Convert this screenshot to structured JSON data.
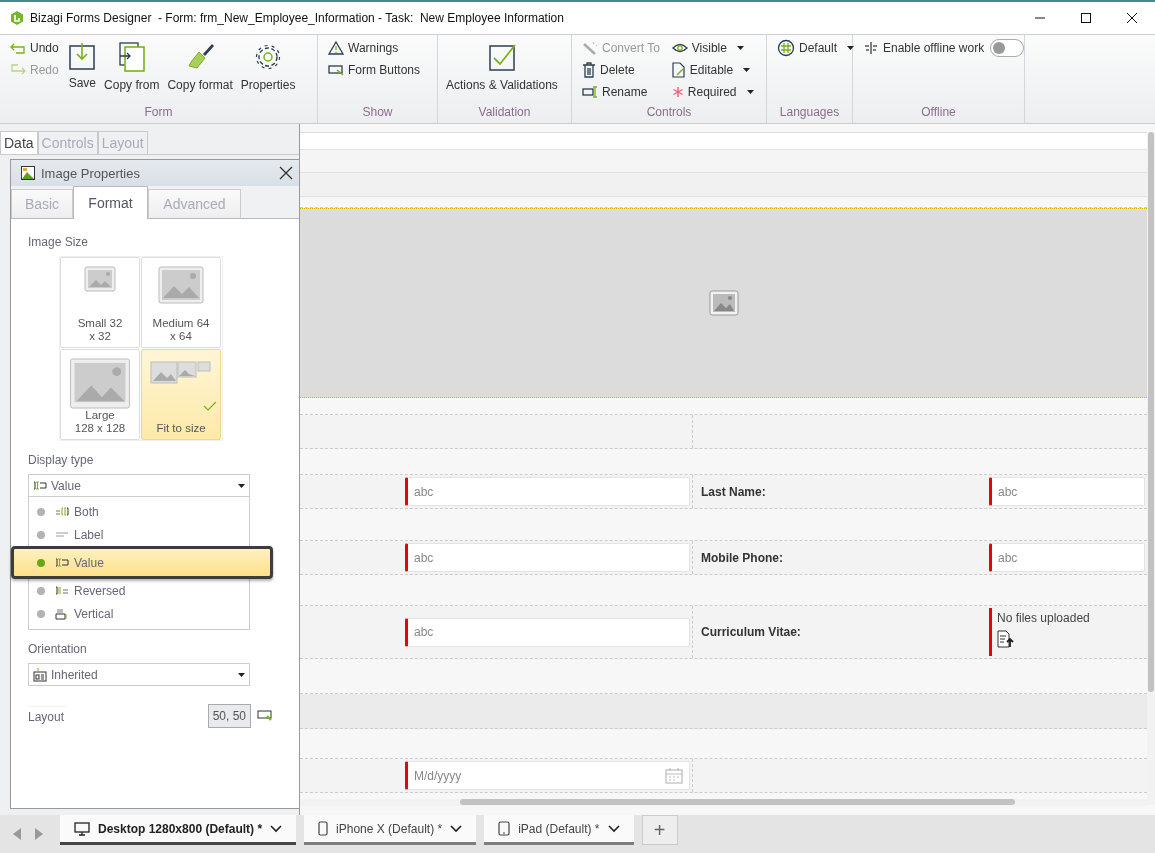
{
  "window": {
    "title": "Bizagi Forms Designer  - Form: frm_New_Employee_Information - Task:  New Employee Information"
  },
  "ribbon": {
    "groups": [
      {
        "label": "Form",
        "columns": [
          {
            "kind": "stack",
            "items": [
              {
                "label": "Undo",
                "disabled": false
              },
              {
                "label": "Redo",
                "disabled": true
              }
            ]
          },
          {
            "kind": "large",
            "items": [
              {
                "label": "Save",
                "disabled": false
              }
            ]
          },
          {
            "kind": "large",
            "items": [
              {
                "label": "Copy from",
                "disabled": false
              }
            ]
          },
          {
            "kind": "large",
            "items": [
              {
                "label": "Copy format",
                "disabled": false
              }
            ]
          },
          {
            "kind": "large",
            "items": [
              {
                "label": "Properties",
                "disabled": false
              }
            ]
          }
        ]
      },
      {
        "label": "Show",
        "columns": [
          {
            "kind": "stack",
            "items": [
              {
                "label": "Warnings",
                "disabled": false
              },
              {
                "label": "Form Buttons",
                "disabled": false
              }
            ]
          }
        ]
      },
      {
        "label": "Validation",
        "columns": [
          {
            "kind": "large",
            "items": [
              {
                "label": "Actions & Validations",
                "disabled": false
              }
            ]
          }
        ]
      },
      {
        "label": "Controls",
        "columns": [
          {
            "kind": "stack",
            "items": [
              {
                "label": "Convert To",
                "disabled": true
              },
              {
                "label": "Delete",
                "disabled": false
              },
              {
                "label": "Rename",
                "disabled": false
              }
            ]
          },
          {
            "kind": "stack",
            "items": [
              {
                "label": "Visible",
                "disabled": false,
                "dropdown": true
              },
              {
                "label": "Editable",
                "disabled": false,
                "dropdown": true
              },
              {
                "label": "Required",
                "disabled": false,
                "dropdown": true
              }
            ]
          }
        ]
      },
      {
        "label": "Languages",
        "columns": [
          {
            "kind": "stack",
            "items": [
              {
                "label": "Default",
                "disabled": false,
                "dropdown": true
              }
            ]
          }
        ]
      },
      {
        "label": "Offline",
        "columns": [
          {
            "kind": "toggle",
            "items": [
              {
                "label": "Enable offline work",
                "disabled": false,
                "on": false
              }
            ]
          }
        ]
      }
    ]
  },
  "side_tabs": [
    {
      "label": "Data",
      "selected": true
    },
    {
      "label": "Controls",
      "selected": false
    },
    {
      "label": "Layout",
      "selected": false
    }
  ],
  "properties": {
    "title": "Image Properties",
    "tabs": [
      {
        "label": "Basic",
        "selected": false
      },
      {
        "label": "Format",
        "selected": true
      },
      {
        "label": "Advanced",
        "selected": false
      }
    ],
    "image_size": {
      "label": "Image Size",
      "options": [
        {
          "label": "Small 32\nx 32",
          "selected": false
        },
        {
          "label": "Medium 64\nx 64",
          "selected": false
        },
        {
          "label": "Large\n128 x 128",
          "selected": false
        },
        {
          "label": "Fit to size",
          "selected": true
        }
      ]
    },
    "display_type": {
      "label": "Display type",
      "value": "Value",
      "expanded": true,
      "options": [
        {
          "label": "Both",
          "selected": false
        },
        {
          "label": "Label",
          "selected": false
        },
        {
          "label": "Value",
          "selected": true
        },
        {
          "label": "Reversed",
          "selected": false
        },
        {
          "label": "Vertical",
          "selected": false
        }
      ]
    },
    "orientation": {
      "label": "Orientation",
      "value": "Inherited"
    },
    "layout": {
      "label": "Layout",
      "value": "50, 50"
    }
  },
  "form": {
    "rows": [
      {
        "kind": "image"
      },
      {
        "kind": "empty"
      },
      {
        "kind": "fields",
        "cells": [
          {
            "kind": "text",
            "placeholder": "abc"
          },
          {
            "kind": "text",
            "label": "Last Name:",
            "placeholder": "abc"
          }
        ]
      },
      {
        "kind": "fields",
        "cells": [
          {
            "kind": "text",
            "placeholder": "abc"
          },
          {
            "kind": "text",
            "label": "Mobile Phone:",
            "placeholder": "abc"
          }
        ]
      },
      {
        "kind": "fields",
        "cells": [
          {
            "kind": "text",
            "placeholder": "abc"
          },
          {
            "kind": "file",
            "label": "Curriculum Vitae:",
            "text": "No files uploaded"
          }
        ]
      },
      {
        "kind": "group"
      },
      {
        "kind": "fields",
        "cells": [
          {
            "kind": "date",
            "placeholder": "M/d/yyyy"
          },
          {
            "kind": "empty"
          }
        ]
      }
    ]
  },
  "device_tabs": [
    {
      "kind": "desktop",
      "label": "Desktop 1280x800 (Default)",
      "mark": "*",
      "selected": true
    },
    {
      "kind": "phone",
      "label": "iPhone X (Default)",
      "mark": "*",
      "selected": false
    },
    {
      "kind": "tablet",
      "label": "iPad (Default)",
      "mark": "*",
      "selected": false
    }
  ],
  "add_tab": "+"
}
